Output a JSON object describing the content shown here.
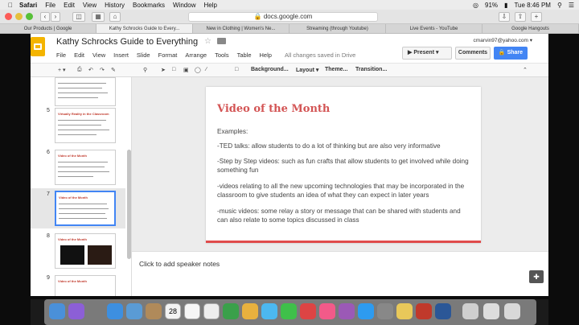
{
  "menubar": {
    "app": "Safari",
    "items": [
      "File",
      "Edit",
      "View",
      "History",
      "Bookmarks",
      "Window",
      "Help"
    ],
    "battery": "91%",
    "time": "Tue 8:46 PM"
  },
  "browser": {
    "address": "docs.google.com",
    "tabs": [
      "Our Products | Google",
      "Kathy Schrocks Guide to Every...",
      "New in Clothing | Women's Ne...",
      "Streaming (through Youtube)",
      "Live Events - YouTube",
      "Google Hangouts"
    ]
  },
  "docs": {
    "title": "Kathy Schrocks Guide to Everything",
    "menus": [
      "File",
      "Edit",
      "View",
      "Insert",
      "Slide",
      "Format",
      "Arrange",
      "Tools",
      "Table",
      "Help"
    ],
    "saved_status": "All changes saved in Drive",
    "account": "cmarvin97@yahoo.com",
    "present_label": "Present",
    "comments_label": "Comments",
    "share_label": "Share"
  },
  "toolbar": {
    "background": "Background...",
    "layout": "Layout",
    "theme": "Theme...",
    "transition": "Transition..."
  },
  "filmstrip": {
    "slides": [
      {
        "num": "5",
        "title": "Virtually Reality in the Classroom"
      },
      {
        "num": "6",
        "title": "Video of the Month"
      },
      {
        "num": "7",
        "title": "Video of the Month"
      },
      {
        "num": "8",
        "title": "Video of the Month"
      },
      {
        "num": "9",
        "title": "Video of the Month"
      }
    ]
  },
  "slide": {
    "title": "Video of the Month",
    "examples": "Examples:",
    "p1": "-TED talks: allow students to do a lot of thinking but are also very informative",
    "p2": "-Step by Step videos: such as fun crafts that allow students to get involved while doing something fun",
    "p3": "-videos relating to all the new upcoming technologies that may be incorporated in the classroom to give students an idea of what they can expect in later years",
    "p4": "-music videos: some relay a story or message that can be shared with students and can also relate to some topics discussed in class"
  },
  "notes": {
    "placeholder": "Click to add speaker notes"
  },
  "colors": {
    "accent": "#d35454",
    "share": "#4285f4",
    "docs_logo": "#f4b400"
  }
}
